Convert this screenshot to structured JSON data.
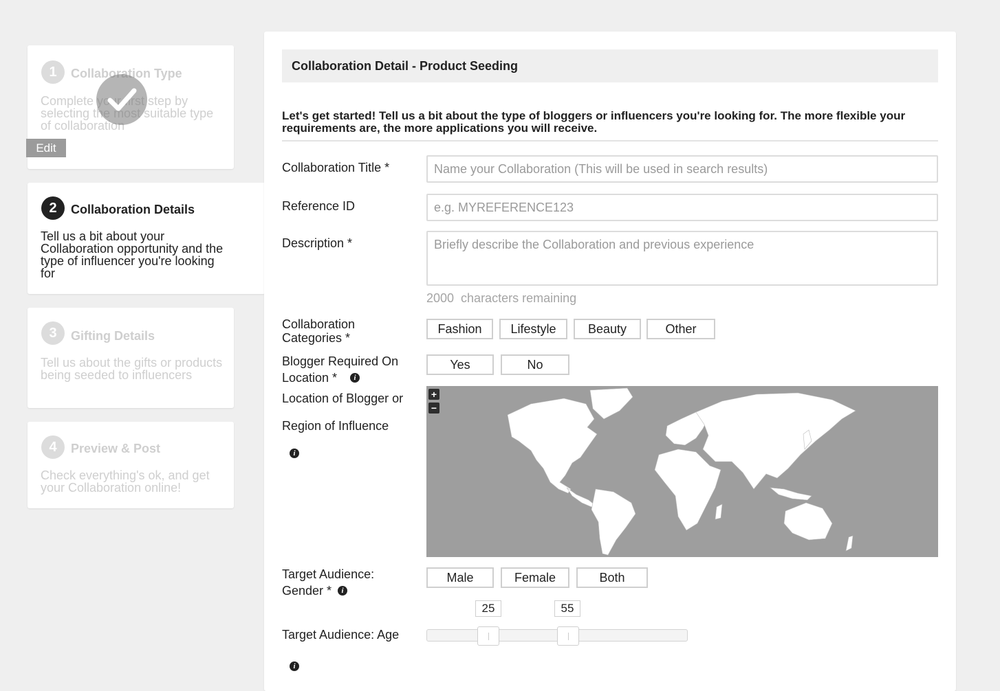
{
  "steps": [
    {
      "num": "1",
      "title": "Collaboration Type",
      "desc": "Complete your first step by selecting the most suitable type of collaboration",
      "edit": "Edit"
    },
    {
      "num": "2",
      "title": "Collaboration Details",
      "desc": "Tell us a bit about your Collaboration opportunity and the type of influencer you're looking for"
    },
    {
      "num": "3",
      "title": "Gifting Details",
      "desc": "Tell us about the gifts or products being seeded to influencers"
    },
    {
      "num": "4",
      "title": "Preview & Post",
      "desc": "Check everything's ok, and get your Collaboration online!"
    }
  ],
  "panel": {
    "title": "Collaboration Detail - Product Seeding",
    "intro": "Let's get started! Tell us a bit about the type of bloggers or influencers you're looking for. The more flexible your requirements are, the more applications you will receive."
  },
  "form": {
    "title_label": "Collaboration Title *",
    "title_placeholder": "Name your Collaboration (This will be used in search results)",
    "ref_label": "Reference ID",
    "ref_placeholder": "e.g. MYREFERENCE123",
    "desc_label": "Description *",
    "desc_placeholder": "Briefly describe the Collaboration and previous experience",
    "chars_remaining": "2000  characters remaining",
    "categories_label": "Collaboration Categories *",
    "categories": [
      "Fashion",
      "Lifestyle",
      "Beauty",
      "Other"
    ],
    "location_req_label": "Blogger Required On Location *",
    "location_req_options": [
      "Yes",
      "No"
    ],
    "location_label_1": "Location of Blogger or",
    "location_label_2": "Region of Influence",
    "gender_label": "Target Audience: Gender *",
    "gender_options": [
      "Male",
      "Female",
      "Both"
    ],
    "age_label": "Target Audience: Age",
    "age_min": "25",
    "age_max": "55"
  },
  "map": {
    "zoom_in": "+",
    "zoom_out": "−",
    "bg_color": "#9e9e9e"
  },
  "info_glyph": "i"
}
